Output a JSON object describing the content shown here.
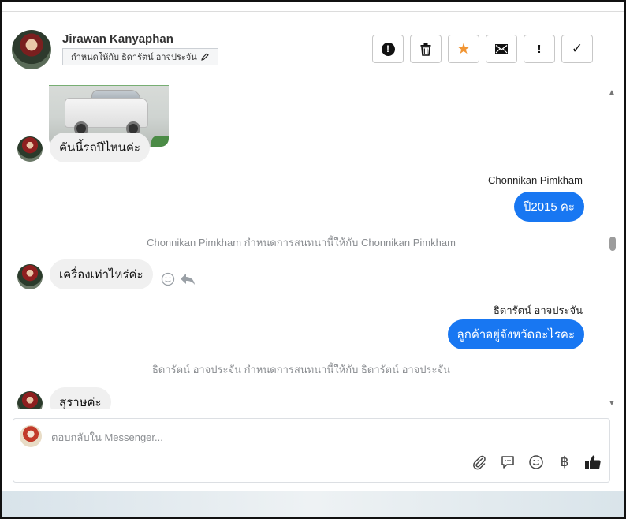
{
  "header": {
    "contact_name": "Jirawan Kanyaphan",
    "assign_label": "กำหนดให้กับ ธิดารัตน์ อาจประจัน"
  },
  "actions": [
    {
      "name": "spam-button",
      "icon": "alert-circle-icon"
    },
    {
      "name": "delete-button",
      "icon": "trash-icon"
    },
    {
      "name": "star-button",
      "icon": "star-icon"
    },
    {
      "name": "mark-unread-button",
      "icon": "envelope-icon"
    },
    {
      "name": "follow-up-button",
      "icon": "exclamation-icon",
      "glyph": "!"
    },
    {
      "name": "done-button",
      "icon": "check-icon",
      "glyph": "✓"
    }
  ],
  "messages": {
    "m1_text": "คันนี้รถปีไหนค่ะ",
    "m2_sender": "Chonnikan Pimkham",
    "m2_text": "ปี2015 คะ",
    "note1": "Chonnikan Pimkham กำหนดการสนทนานี้ให้กับ Chonnikan Pimkham",
    "m3_text": "เครื่องเท่าไหร่ค่ะ",
    "m4_sender": "ธิดารัตน์ อาจประจัน",
    "m4_text": "ลูกค้าอยู่จังหวัดอะไรคะ",
    "note2": "ธิดารัตน์ อาจประจัน กำหนดการสนทนานี้ให้กับ ธิดารัตน์ อาจประจัน",
    "m5_text": "สุราษค่ะ"
  },
  "composer": {
    "placeholder": "ตอบกลับใน Messenger...",
    "tools": [
      "paperclip-icon",
      "saved-reply-icon",
      "emoji-icon",
      "baht-icon",
      "thumbs-up-icon"
    ],
    "baht_glyph": "฿"
  },
  "colors": {
    "accent": "#1877f2",
    "star": "#f19533"
  }
}
